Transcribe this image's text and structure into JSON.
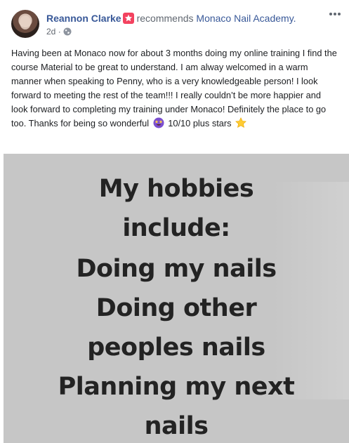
{
  "post": {
    "author": "Reannon Clarke",
    "action_text": "recommends",
    "page_name": "Monaco Nail Academy.",
    "timestamp": "2d",
    "separator": "·",
    "privacy_icon": "globe-icon",
    "recommend_icon": "recommend-badge-icon",
    "more_icon": "more-options-icon",
    "body_main": "Having been at Monaco now for about 3 months doing my online training I find the course Material to be great to understand. I am alway welcomed in a warm manner when speaking to Penny, who is a very knowledgeable person! I look forward to meeting the rest of the team!!! I really couldn’t be more happier and look forward to completing my training under Monaco! Definitely the place to go too. Thanks for being so wonderful",
    "body_after_emoji": "10/10 plus stars",
    "emojis": [
      "star-struck-emoji",
      "star-emoji"
    ],
    "photo_text_lines": [
      "My hobbies",
      "include:",
      "Doing my nails",
      "Doing other",
      "peoples nails",
      "Planning my next",
      "nails"
    ]
  },
  "colors": {
    "link": "#385898",
    "recommend_badge": "#f3425f",
    "photo_background": "#c6c6c6",
    "photo_text": "#232323"
  }
}
